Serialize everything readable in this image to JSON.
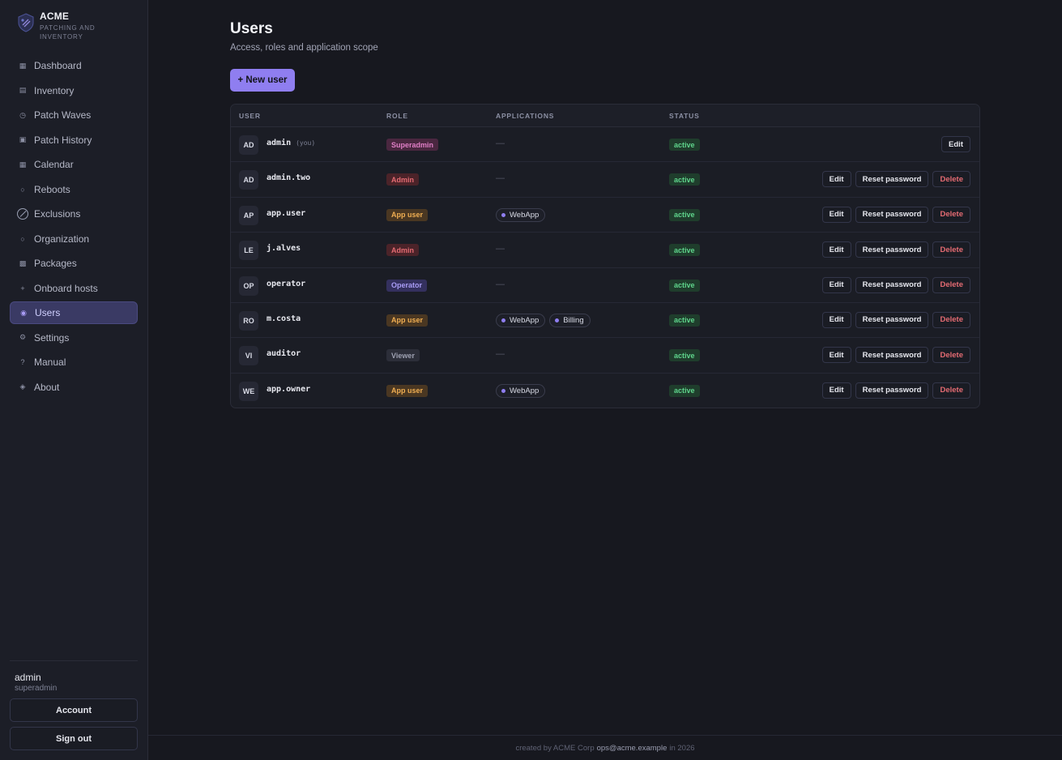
{
  "brand": {
    "name": "ACME",
    "subtitle": "PATCHING AND INVENTORY"
  },
  "sidebar": {
    "items": [
      {
        "label": "Dashboard",
        "icon": "dashboard-icon",
        "glyph": "▦",
        "active": false
      },
      {
        "label": "Inventory",
        "icon": "inventory-icon",
        "glyph": "▤",
        "active": false
      },
      {
        "label": "Patch Waves",
        "icon": "clock-icon",
        "glyph": "◷",
        "active": false
      },
      {
        "label": "Patch History",
        "icon": "history-icon",
        "glyph": "▣",
        "active": false
      },
      {
        "label": "Calendar",
        "icon": "calendar-icon",
        "glyph": "▦",
        "active": false
      },
      {
        "label": "Reboots",
        "icon": "reboot-icon",
        "glyph": "○",
        "active": false
      },
      {
        "label": "Exclusions",
        "icon": "exclusion-icon",
        "glyph": "",
        "active": false
      },
      {
        "label": "Organization",
        "icon": "organization-icon",
        "glyph": "○",
        "active": false
      },
      {
        "label": "Packages",
        "icon": "package-icon",
        "glyph": "▩",
        "active": false
      },
      {
        "label": "Onboard hosts",
        "icon": "plus-icon",
        "glyph": "+",
        "active": false
      },
      {
        "label": "Users",
        "icon": "users-icon",
        "glyph": "◉",
        "active": true
      },
      {
        "label": "Settings",
        "icon": "gear-icon",
        "glyph": "⚙",
        "active": false
      },
      {
        "label": "Manual",
        "icon": "help-icon",
        "glyph": "?",
        "active": false
      },
      {
        "label": "About",
        "icon": "info-icon",
        "glyph": "◈",
        "active": false
      }
    ],
    "user": {
      "name": "admin",
      "role": "superadmin"
    },
    "account_label": "Account",
    "signout_label": "Sign out"
  },
  "page": {
    "title": "Users",
    "subtitle": "Access, roles and application scope",
    "new_button": "+ New user"
  },
  "table": {
    "columns": [
      "USER",
      "ROLE",
      "APPLICATIONS",
      "STATUS"
    ],
    "empty_apps": "—",
    "you_label": "(you)",
    "action_labels": {
      "edit": "Edit",
      "reset": "Reset password",
      "delete": "Delete"
    },
    "rows": [
      {
        "initials": "AD",
        "username": "admin",
        "you": true,
        "role": "Superadmin",
        "role_class": "superadmin",
        "apps": [],
        "status": "active",
        "actions": [
          "edit"
        ]
      },
      {
        "initials": "AD",
        "username": "admin.two",
        "you": false,
        "role": "Admin",
        "role_class": "admin",
        "apps": [],
        "status": "active",
        "actions": [
          "edit",
          "reset",
          "delete"
        ]
      },
      {
        "initials": "AP",
        "username": "app.user",
        "you": false,
        "role": "App user",
        "role_class": "appuser",
        "apps": [
          "WebApp"
        ],
        "status": "active",
        "actions": [
          "edit",
          "reset",
          "delete"
        ]
      },
      {
        "initials": "LE",
        "username": "j.alves",
        "you": false,
        "role": "Admin",
        "role_class": "admin",
        "apps": [],
        "status": "active",
        "actions": [
          "edit",
          "reset",
          "delete"
        ]
      },
      {
        "initials": "OP",
        "username": "operator",
        "you": false,
        "role": "Operator",
        "role_class": "operator",
        "apps": [],
        "status": "active",
        "actions": [
          "edit",
          "reset",
          "delete"
        ]
      },
      {
        "initials": "RO",
        "username": "m.costa",
        "you": false,
        "role": "App user",
        "role_class": "appuser",
        "apps": [
          "WebApp",
          "Billing"
        ],
        "status": "active",
        "actions": [
          "edit",
          "reset",
          "delete"
        ]
      },
      {
        "initials": "VI",
        "username": "auditor",
        "you": false,
        "role": "Viewer",
        "role_class": "viewer",
        "apps": [],
        "status": "active",
        "actions": [
          "edit",
          "reset",
          "delete"
        ]
      },
      {
        "initials": "WE",
        "username": "app.owner",
        "you": false,
        "role": "App user",
        "role_class": "appuser",
        "apps": [
          "WebApp"
        ],
        "status": "active",
        "actions": [
          "edit",
          "reset",
          "delete"
        ]
      }
    ]
  },
  "footer": {
    "prefix": "created by ACME Corp",
    "email": "ops@acme.example",
    "suffix": "in 2026"
  },
  "colors": {
    "accent": "#8f7ef0",
    "background": "#17181f",
    "sidebar": "#1c1e27",
    "success": "#5fd58c",
    "danger": "#e46b72"
  }
}
